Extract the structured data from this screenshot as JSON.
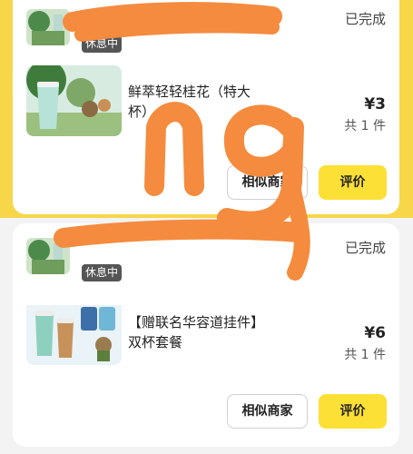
{
  "orders": [
    {
      "status": "已完成",
      "rest_badge": "休息中",
      "product_name": "鲜萃轻轻桂花（特大杯）",
      "price": "¥3",
      "quantity": "共 1 件",
      "similar_label": "相似商家",
      "review_label": "评价"
    },
    {
      "status": "已完成",
      "rest_badge": "休息中",
      "product_name": "【赠联名华容道挂件】双杯套餐",
      "price": "¥6",
      "quantity": "共 1 件",
      "similar_label": "相似商家",
      "review_label": "评价"
    }
  ],
  "annotation": {
    "handwritten_text": "ng",
    "color": "#f58b3e"
  },
  "colors": {
    "accent_yellow": "#fde035",
    "header_yellow": "#f7d64a"
  }
}
